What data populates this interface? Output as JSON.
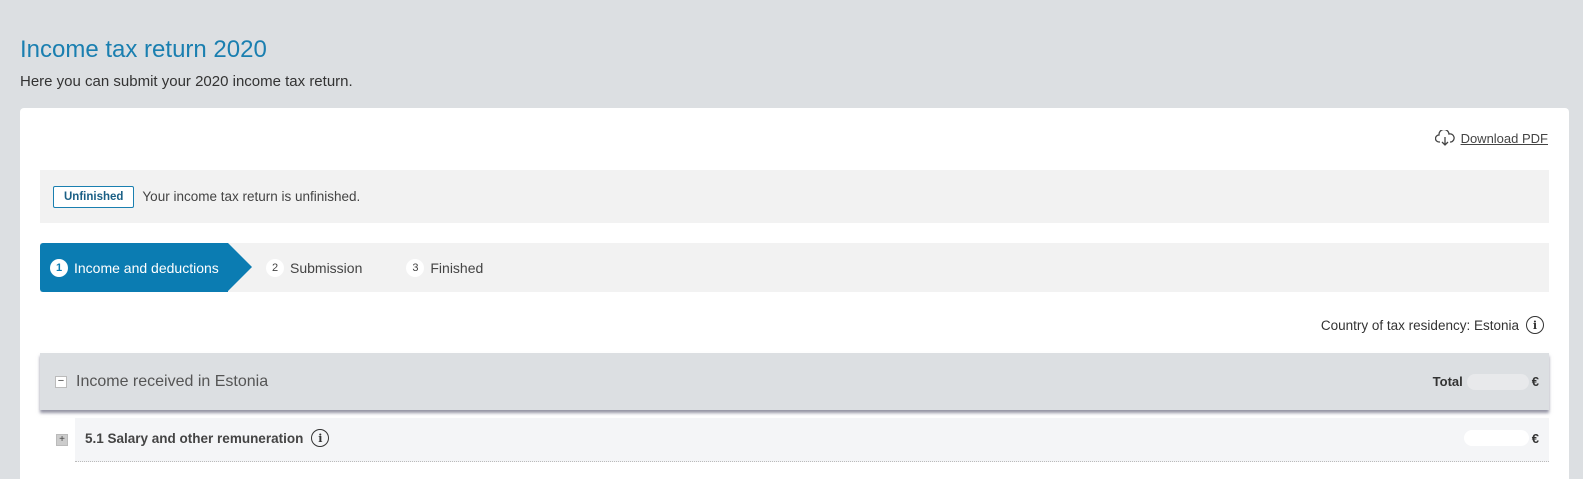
{
  "header": {
    "title": "Income tax return 2020",
    "subtitle": "Here you can submit your 2020 income tax return."
  },
  "download": {
    "label": "Download PDF",
    "icon": "cloud-download-icon"
  },
  "status": {
    "badge": "Unfinished",
    "message": "Your income tax return is unfinished."
  },
  "steps": [
    {
      "number": "1",
      "label": "Income and deductions",
      "active": true
    },
    {
      "number": "2",
      "label": "Submission",
      "active": false
    },
    {
      "number": "3",
      "label": "Finished",
      "active": false
    }
  ],
  "residency": {
    "label": "Country of tax residency: Estonia",
    "icon": "info-icon"
  },
  "section": {
    "toggle": "−",
    "title": "Income received in Estonia",
    "total_label": "Total",
    "total_currency": "€"
  },
  "rows": [
    {
      "toggle": "+",
      "label": "5.1 Salary and other remuneration",
      "currency": "€"
    }
  ],
  "colors": {
    "accent": "#0b7cb2",
    "title": "#1a7fb0",
    "background": "#dcdfe2"
  }
}
